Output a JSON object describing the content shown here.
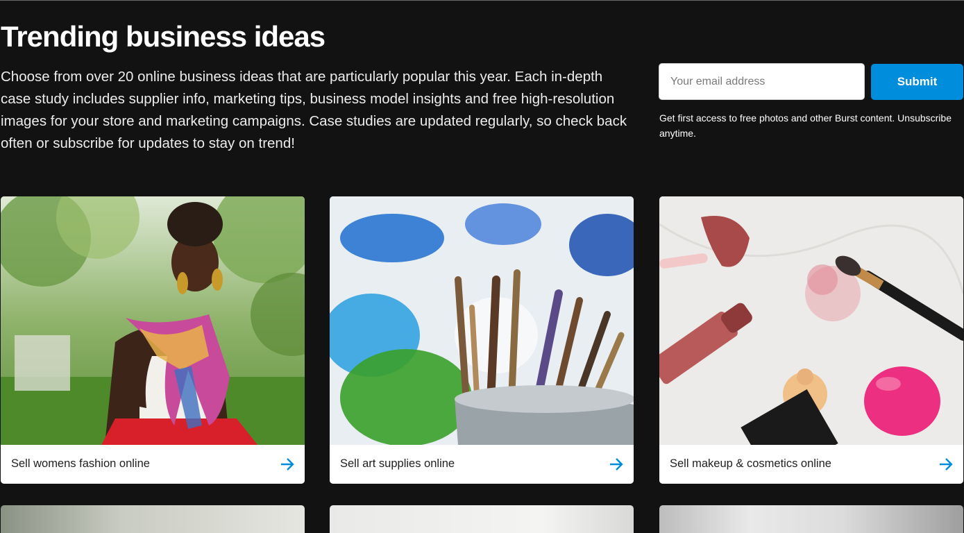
{
  "page": {
    "title": "Trending business ideas",
    "description": "Choose from over 20 online business ideas that are particularly popular this year. Each in-depth case study includes supplier info, marketing tips, business model insights and free high-resolution images for your store and marketing campaigns. Case studies are updated regularly, so check back often or subscribe for updates to stay on trend!"
  },
  "subscribe": {
    "email_placeholder": "Your email address",
    "email_value": "",
    "submit_label": "Submit",
    "note": "Get first access to free photos and other Burst content. Unsubscribe anytime."
  },
  "cards": [
    {
      "label": "Sell womens fashion online",
      "icon": "arrow-right-icon"
    },
    {
      "label": "Sell art supplies online",
      "icon": "arrow-right-icon"
    },
    {
      "label": "Sell makeup & cosmetics online",
      "icon": "arrow-right-icon"
    }
  ],
  "colors": {
    "background": "#121212",
    "accent": "#008ddb",
    "card_text": "#212121"
  }
}
